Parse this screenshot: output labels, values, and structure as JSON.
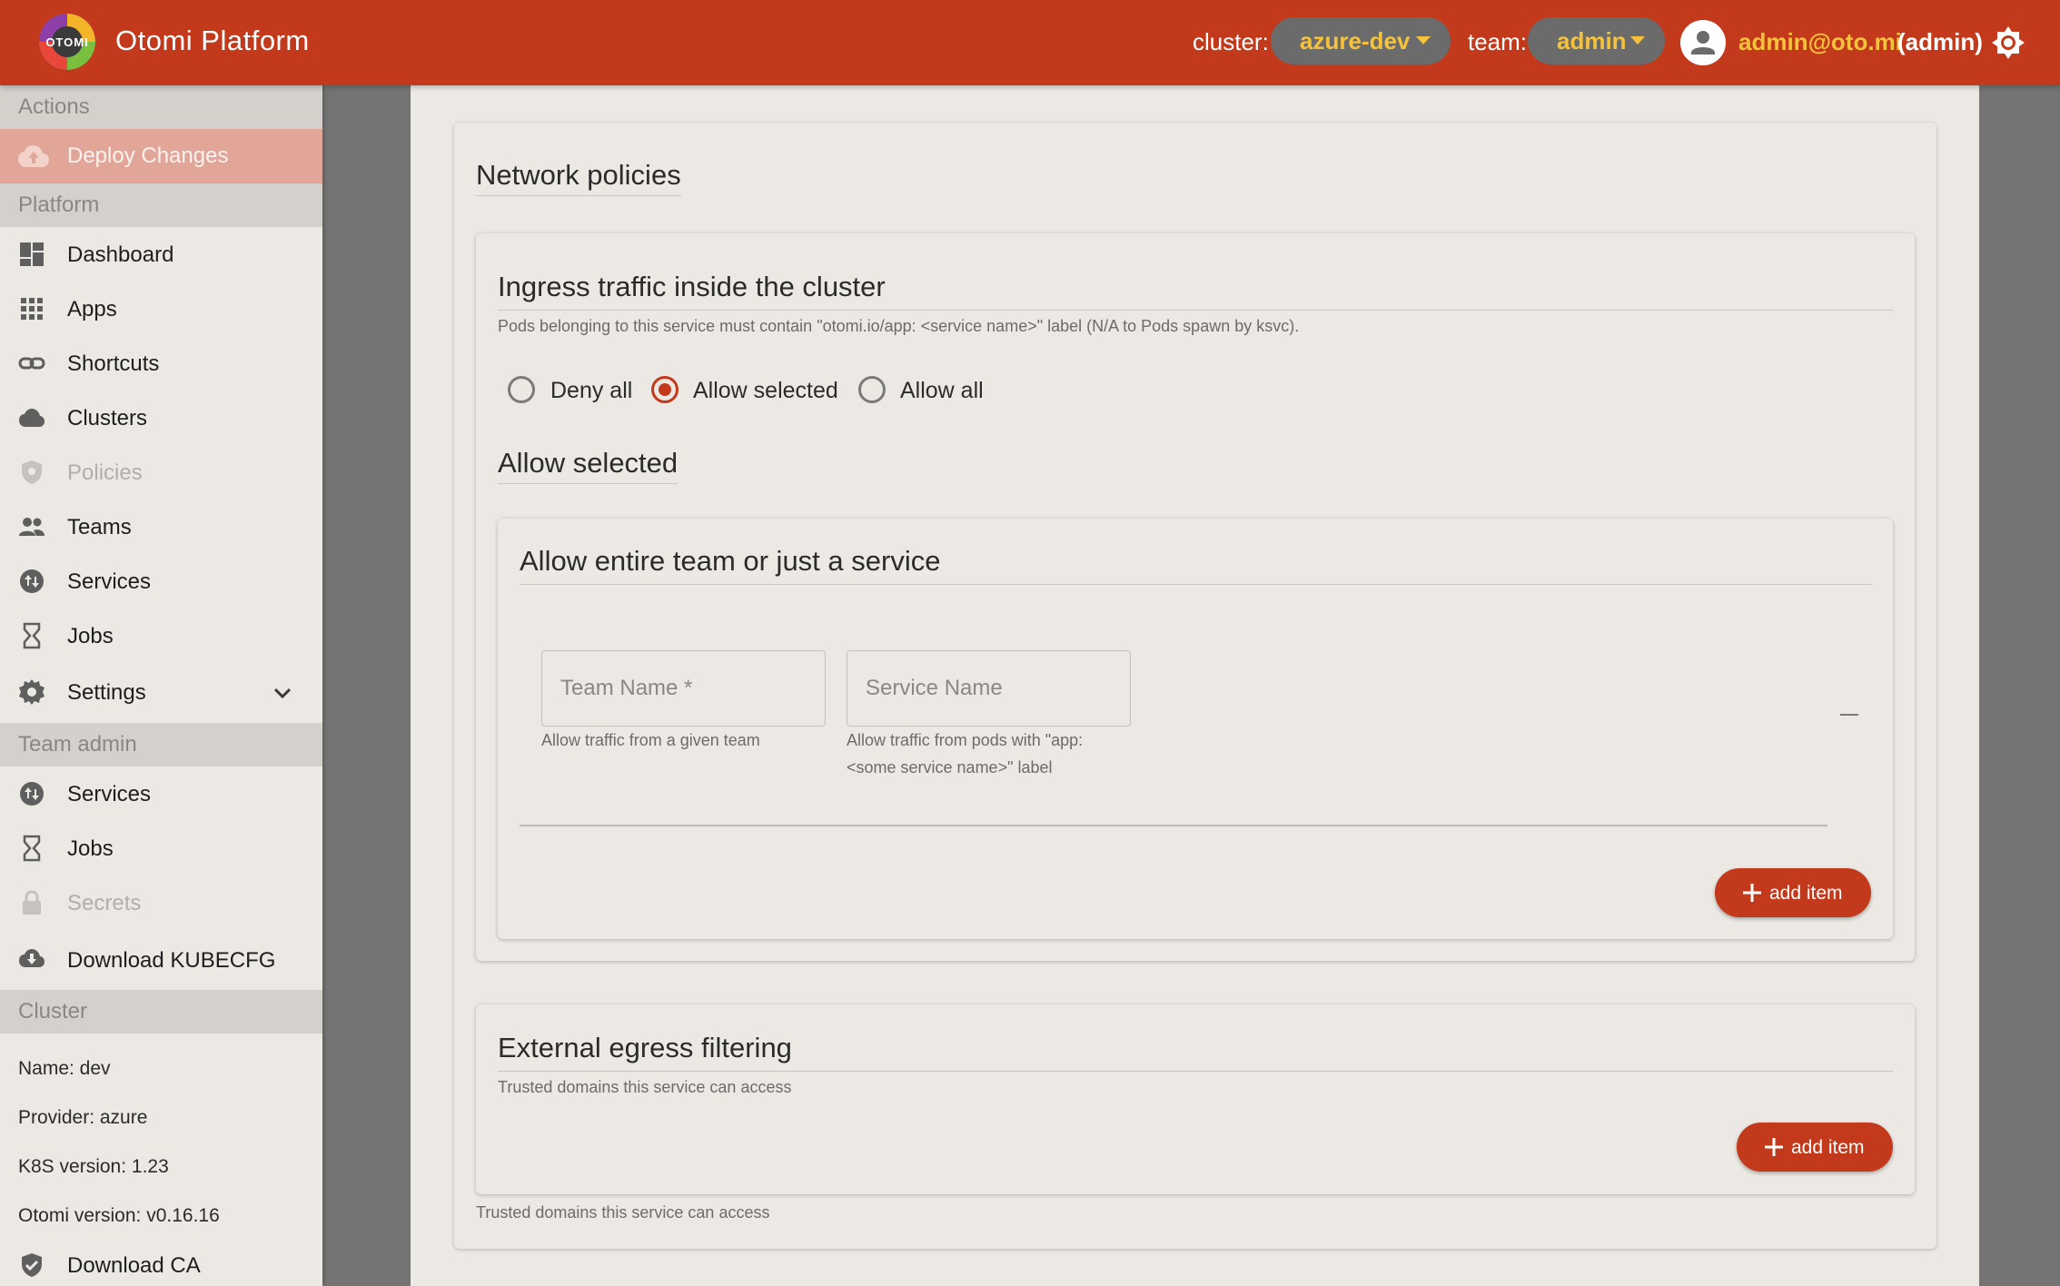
{
  "header": {
    "logo_text": "OTOMI",
    "title": "Otomi Platform",
    "cluster_label": "cluster:",
    "cluster_value": "azure-dev",
    "team_label": "team:",
    "team_value": "admin",
    "user_email": "admin@oto.mi",
    "user_role": "(admin)"
  },
  "sidebar": {
    "actions_header": "Actions",
    "deploy_label": "Deploy Changes",
    "platform_header": "Platform",
    "platform_items": [
      {
        "label": "Dashboard"
      },
      {
        "label": "Apps"
      },
      {
        "label": "Shortcuts"
      },
      {
        "label": "Clusters"
      },
      {
        "label": "Policies"
      },
      {
        "label": "Teams"
      },
      {
        "label": "Services"
      },
      {
        "label": "Jobs"
      },
      {
        "label": "Settings"
      }
    ],
    "team_header": "Team admin",
    "team_items": [
      {
        "label": "Services"
      },
      {
        "label": "Jobs"
      },
      {
        "label": "Secrets"
      },
      {
        "label": "Download KUBECFG"
      }
    ],
    "cluster_header": "Cluster",
    "cluster_info": {
      "name": "Name: dev",
      "provider": "Provider: azure",
      "k8s": "K8S version: 1.23",
      "otomi": "Otomi version: v0.16.16"
    },
    "download_ca": "Download CA"
  },
  "main": {
    "section_title": "Network policies",
    "ingress": {
      "title": "Ingress traffic inside the cluster",
      "help": "Pods belonging to this service must contain \"otomi.io/app: <service name>\" label (N/A to Pods spawn by ksvc).",
      "options": [
        "Deny all",
        "Allow selected",
        "Allow all"
      ],
      "selected": "Allow selected",
      "subsection_title": "Allow selected",
      "allow_card_title": "Allow entire team or just a service",
      "team_field_placeholder": "Team Name *",
      "team_field_help": "Allow traffic from a given team",
      "service_field_placeholder": "Service Name",
      "service_field_help_1": "Allow traffic from pods with \"app:",
      "service_field_help_2": "<some service name>\" label",
      "add_item_label": "add item"
    },
    "egress": {
      "title": "External egress filtering",
      "help": "Trusted domains this service can access",
      "add_item_label": "add item",
      "footer_help": "Trusted domains this service can access"
    }
  },
  "colors": {
    "brand": "#c2391b",
    "accent_yellow": "#f5c33b",
    "background": "#ece8e4"
  }
}
